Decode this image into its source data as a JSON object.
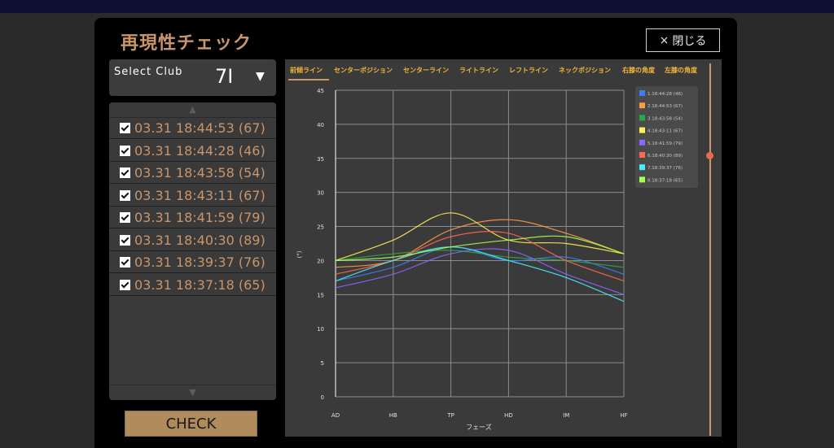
{
  "title": "再現性チェック",
  "close_button": {
    "icon": "×",
    "label": "閉じる"
  },
  "club_select": {
    "label": "Select Club",
    "value": "7I",
    "caret": "▼"
  },
  "list": {
    "scroll_up": "▲",
    "scroll_down": "▼",
    "items": [
      {
        "label": "03.31 18:44:53 (67)",
        "checked": true
      },
      {
        "label": "03.31 18:44:28 (46)",
        "checked": true
      },
      {
        "label": "03.31 18:43:58 (54)",
        "checked": true
      },
      {
        "label": "03.31 18:43:11 (67)",
        "checked": true
      },
      {
        "label": "03.31 18:41:59 (79)",
        "checked": true
      },
      {
        "label": "03.31 18:40:30 (89)",
        "checked": true
      },
      {
        "label": "03.31 18:39:37 (76)",
        "checked": true
      },
      {
        "label": "03.31 18:37:18 (65)",
        "checked": true
      }
    ]
  },
  "check_button": "CHECK",
  "tabs": [
    {
      "label": "前傾ライン",
      "active": true
    },
    {
      "label": "センターポジション",
      "active": false
    },
    {
      "label": "センターライン",
      "active": false
    },
    {
      "label": "ライトライン",
      "active": false
    },
    {
      "label": "レフトライン",
      "active": false
    },
    {
      "label": "ネックポジション",
      "active": false
    },
    {
      "label": "右膝の角度",
      "active": false
    },
    {
      "label": "左膝の角度",
      "active": false
    }
  ],
  "chart_data": {
    "type": "line",
    "categories": [
      "AD",
      "HB",
      "TP",
      "HD",
      "IM",
      "HF"
    ],
    "xlabel": "フェーズ",
    "ylabel": "(°)",
    "ylim": [
      0,
      45
    ],
    "yticks": [
      0,
      5,
      10,
      15,
      20,
      25,
      30,
      35,
      40,
      45
    ],
    "grid": true,
    "legend_position": "top-right",
    "series": [
      {
        "name": "1.18:44:28 (46)",
        "color": "#3d7ef5",
        "values": [
          17,
          19,
          22,
          20,
          20.5,
          18
        ]
      },
      {
        "name": "2.18:44:53 (67)",
        "color": "#ff9944",
        "values": [
          19,
          20,
          24.5,
          26,
          24,
          21
        ]
      },
      {
        "name": "3.18:43:58 (54)",
        "color": "#2aa84a",
        "values": [
          20,
          21,
          21.5,
          20.5,
          20,
          19
        ]
      },
      {
        "name": "4.18:43:11 (67)",
        "color": "#ffee55",
        "values": [
          20,
          23,
          27,
          23,
          22.5,
          21
        ]
      },
      {
        "name": "5.18:41:59 (79)",
        "color": "#8866ff",
        "values": [
          16,
          18,
          21,
          21.5,
          18,
          15
        ]
      },
      {
        "name": "6.18:40:30 (89)",
        "color": "#ff6655",
        "values": [
          18,
          20,
          23.5,
          24,
          20,
          17
        ]
      },
      {
        "name": "7.18:39:37 (76)",
        "color": "#44eeff",
        "values": [
          17,
          20,
          22,
          20,
          17.5,
          14
        ]
      },
      {
        "name": "8.18:37:18 (65)",
        "color": "#aaff55",
        "values": [
          20,
          20.5,
          22,
          23,
          23.5,
          21
        ]
      }
    ]
  }
}
